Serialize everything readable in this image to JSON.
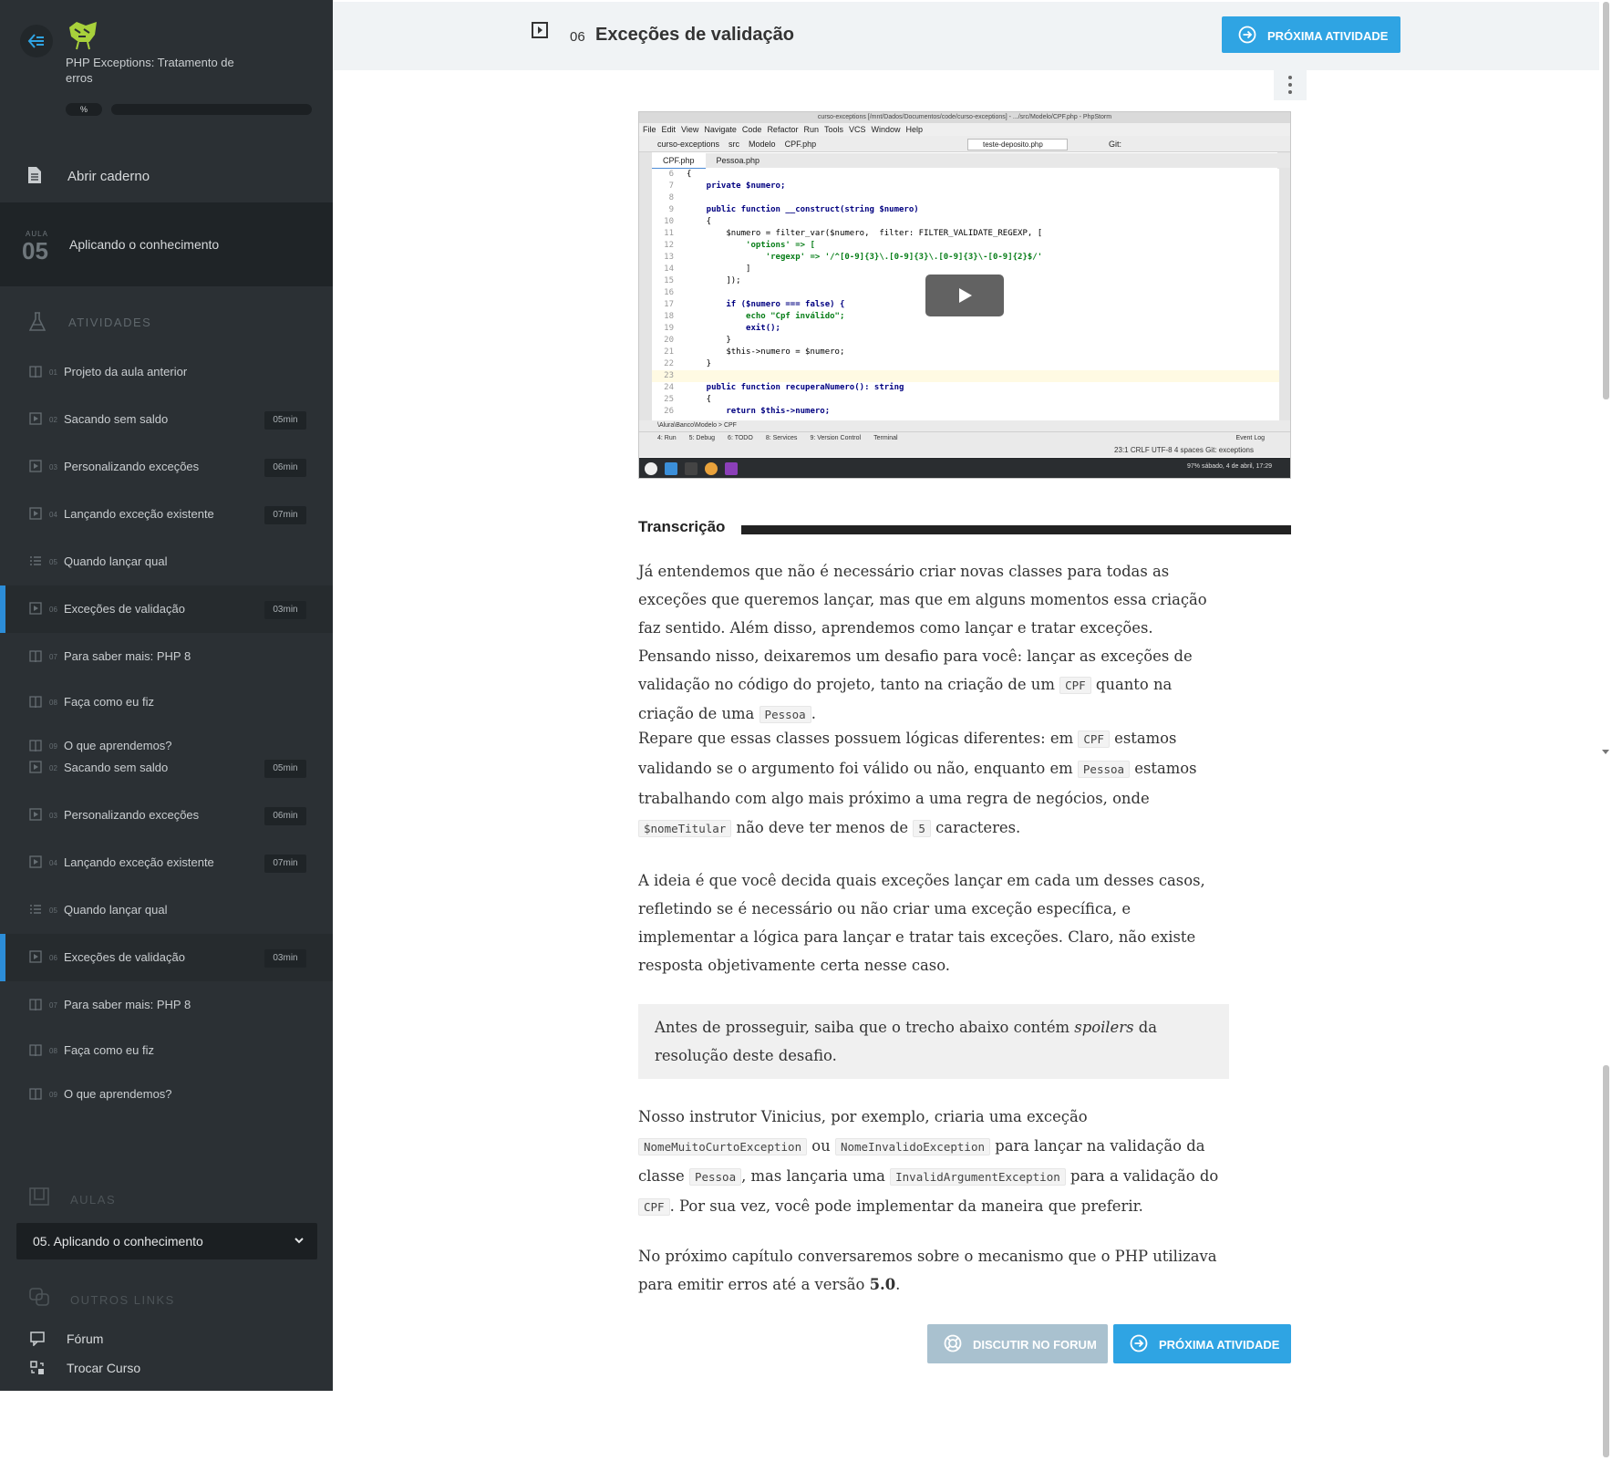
{
  "sidebar": {
    "course_title": "PHP Exceptions: Tratamento de erros",
    "progress_percent_label": "%",
    "notebook_label": "Abrir caderno",
    "current_lesson": {
      "aula_label": "AULA",
      "number": "05",
      "title": "Aplicando o conhecimento"
    },
    "activities_header": "ATIVIDADES",
    "activities": [
      {
        "num": "01",
        "label": "Projeto da aula anterior",
        "duration": "",
        "icon": "book-icon",
        "active": false
      },
      {
        "num": "02",
        "label": "Sacando sem saldo",
        "duration": "05min",
        "icon": "video-icon",
        "active": false
      },
      {
        "num": "03",
        "label": "Personalizando exceções",
        "duration": "06min",
        "icon": "video-icon",
        "active": false
      },
      {
        "num": "04",
        "label": "Lançando exceção existente",
        "duration": "07min",
        "icon": "video-icon",
        "active": false
      },
      {
        "num": "05",
        "label": "Quando lançar qual",
        "duration": "",
        "icon": "list-icon",
        "active": false
      },
      {
        "num": "06",
        "label": "Exceções de validação",
        "duration": "03min",
        "icon": "video-icon",
        "active": true
      },
      {
        "num": "07",
        "label": "Para saber mais: PHP 8",
        "duration": "",
        "icon": "book-icon",
        "active": false
      },
      {
        "num": "08",
        "label": "Faça como eu fiz",
        "duration": "",
        "icon": "book-icon",
        "active": false
      },
      {
        "num": "09",
        "label": "O que aprendemos?",
        "duration": "",
        "icon": "book-icon",
        "active": false
      },
      {
        "num": "02",
        "label": "Sacando sem saldo",
        "duration": "05min",
        "icon": "video-icon",
        "active": false
      },
      {
        "num": "03",
        "label": "Personalizando exceções",
        "duration": "06min",
        "icon": "video-icon",
        "active": false
      },
      {
        "num": "04",
        "label": "Lançando exceção existente",
        "duration": "07min",
        "icon": "video-icon",
        "active": false
      },
      {
        "num": "05",
        "label": "Quando lançar qual",
        "duration": "",
        "icon": "list-icon",
        "active": false
      },
      {
        "num": "06",
        "label": "Exceções de validação",
        "duration": "03min",
        "icon": "video-icon",
        "active": true
      },
      {
        "num": "07",
        "label": "Para saber mais: PHP 8",
        "duration": "",
        "icon": "book-icon",
        "active": false
      },
      {
        "num": "08",
        "label": "Faça como eu fiz",
        "duration": "",
        "icon": "book-icon",
        "active": false
      },
      {
        "num": "09",
        "label": "O que aprendemos?",
        "duration": "",
        "icon": "book-icon",
        "active": false
      }
    ],
    "aulas_header": "AULAS",
    "aulas_selected": "05. Aplicando o conhecimento",
    "links_header": "OUTROS LINKS",
    "links": [
      {
        "label": "Fórum",
        "icon": "forum-icon"
      },
      {
        "label": "Trocar Curso",
        "icon": "switch-course-icon"
      }
    ]
  },
  "header": {
    "activity_number": "06",
    "activity_title": "Exceções de validação",
    "next_button": "PRÓXIMA ATIVIDADE"
  },
  "video": {
    "window_title": "curso-exceptions [/mnt/Dados/Documentos/code/curso-exceptions] - .../src/Modelo/CPF.php - PhpStorm",
    "menu": [
      "File",
      "Edit",
      "View",
      "Navigate",
      "Code",
      "Refactor",
      "Run",
      "Tools",
      "VCS",
      "Window",
      "Help"
    ],
    "breadcrumb": [
      "curso-exceptions",
      "src",
      "Modelo",
      "CPF.php"
    ],
    "run_config": "teste-deposito.php",
    "git_label": "Git:",
    "tabs": [
      "CPF.php",
      "Pessoa.php"
    ],
    "code_lines": [
      {
        "n": "6",
        "text": "{"
      },
      {
        "n": "7",
        "text": "    private $numero;"
      },
      {
        "n": "8",
        "text": ""
      },
      {
        "n": "9",
        "text": "    public function __construct(string $numero)"
      },
      {
        "n": "10",
        "text": "    {"
      },
      {
        "n": "11",
        "text": "        $numero = filter_var($numero,  filter: FILTER_VALIDATE_REGEXP, ["
      },
      {
        "n": "12",
        "text": "            'options' => ["
      },
      {
        "n": "13",
        "text": "                'regexp' => '/^[0-9]{3}\\.[0-9]{3}\\.[0-9]{3}\\-[0-9]{2}$/'"
      },
      {
        "n": "14",
        "text": "            ]"
      },
      {
        "n": "15",
        "text": "        ]);"
      },
      {
        "n": "16",
        "text": ""
      },
      {
        "n": "17",
        "text": "        if ($numero === false) {"
      },
      {
        "n": "18",
        "text": "            echo \"Cpf inválido\";"
      },
      {
        "n": "19",
        "text": "            exit();"
      },
      {
        "n": "20",
        "text": "        }"
      },
      {
        "n": "21",
        "text": "        $this->numero = $numero;"
      },
      {
        "n": "22",
        "text": "    }"
      },
      {
        "n": "23",
        "text": ""
      },
      {
        "n": "24",
        "text": "    public function recuperaNumero(): string"
      },
      {
        "n": "25",
        "text": "    {"
      },
      {
        "n": "26",
        "text": "        return $this->numero;"
      }
    ],
    "bottom_breadcrumb": "\\Alura\\Banco\\Modelo  >  CPF",
    "tool_windows": [
      "4: Run",
      "5: Debug",
      "6: TODO",
      "8: Services",
      "9: Version Control",
      "Terminal",
      "Event Log"
    ],
    "status": "23:1   CRLF   UTF-8   4 spaces   Git: exceptions",
    "clock": "97%  sábado, 4 de abril, 17:29"
  },
  "content": {
    "transcription_label": "Transcrição",
    "p1": {
      "a": "Já entendemos que não é necessário criar novas classes para todas as exceções que queremos lançar, mas que em alguns momentos essa criação faz sentido. Além disso, aprendemos como lançar e tratar exceções. Pensando nisso, deixaremos um desafio para você: lançar as exceções de validação no código do projeto, tanto na criação de um ",
      "c1": "CPF",
      "b": " quanto na criação de uma ",
      "c2": "Pessoa",
      "d": "."
    },
    "p2": {
      "a": "Repare que essas classes possuem lógicas diferentes: em ",
      "c1": "CPF",
      "b": " estamos validando se o argumento foi válido ou não, enquanto em ",
      "c2": "Pessoa",
      "c": " estamos trabalhando com algo mais próximo a uma regra de negócios, onde ",
      "c3": "$nomeTitular",
      "d": " não deve ter menos de ",
      "c4": "5",
      "e": " caracteres."
    },
    "p3": "A ideia é que você decida quais exceções lançar em cada um desses casos, refletindo se é necessário ou não criar uma exceção específica, e implementar a lógica para lançar e tratar tais exceções. Claro, não existe resposta objetivamente certa nesse caso.",
    "quote": {
      "a": "Antes de prosseguir, saiba que o trecho abaixo contém ",
      "em": "spoilers",
      "b": " da resolução deste desafio."
    },
    "p4": {
      "a": "Nosso instrutor Vinicius, por exemplo, criaria uma exceção ",
      "c1": "NomeMuitoCurtoException",
      "b": " ou ",
      "c2": "NomeInvalidoException",
      "c": " para lançar na validação da classe ",
      "c3": "Pessoa",
      "d": ", mas lançaria uma ",
      "c4": "InvalidArgumentException",
      "e": " para a validação do ",
      "c5": "CPF",
      "f": ". Por sua vez, você pode implementar da maneira que preferir."
    },
    "p5": {
      "a": "No próximo capítulo conversaremos sobre o mecanismo que o PHP utilizava para emitir erros até a versão ",
      "strong": "5.0",
      "b": "."
    },
    "forum_button": "DISCUTIR NO FORUM",
    "next_button": "PRÓXIMA ATIVIDADE"
  },
  "colors": {
    "accent": "#2fa4e3",
    "sidebar_bg": "#2b3034",
    "active_marker": "#2c8dd8"
  }
}
